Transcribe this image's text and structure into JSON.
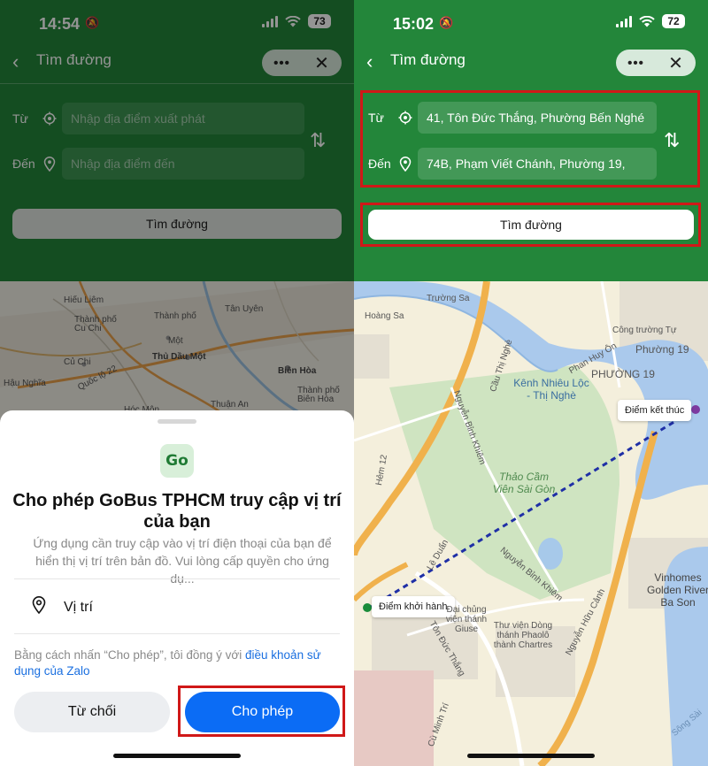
{
  "left": {
    "status": {
      "time": "14:54",
      "battery": "73"
    },
    "nav": {
      "title": "Tìm đường"
    },
    "form": {
      "from_label": "Từ",
      "to_label": "Đến",
      "from_placeholder": "Nhập địa điểm xuất phát",
      "to_placeholder": "Nhập địa điểm đến",
      "search_label": "Tìm đường"
    },
    "map_labels": {
      "hieu_liem": "Hiếu Liêm",
      "tan_uyen": "Tân Uyên",
      "thanh_pho_left": "Thành phố",
      "cu_chi_top": "Cu Chi",
      "thanh_pho_mid": "Thành phố",
      "mot": "Một",
      "thu_dau_mot": "Thủ Dầu Một",
      "bien_hoa": "Biên Hòa",
      "cu_chi": "Củ Chi",
      "quoc_lo": "Quốc lộ 22",
      "thanh_pho_right": "Thành phố",
      "bien_hoa_2": "Biên Hòa",
      "hau_nghia": "Hậu Nghĩa",
      "hoc_mon": "Hóc Môn",
      "thuan_an": "Thuận An"
    },
    "sheet": {
      "logo": "Go",
      "title": "Cho phép GoBus TPHCM truy cập vị trí của bạn",
      "description": "Ứng dụng cần truy cập vào vị trí điện thoại của bạn để hiển thị vị trí trên bản đồ. Vui lòng cấp quyền cho ứng dụ...",
      "permission": "Vị trí",
      "terms_text": "Bằng cách nhấn “Cho phép”, tôi đồng ý với ",
      "terms_link": "điều khoản sử dụng của Zalo",
      "deny": "Từ chối",
      "allow": "Cho phép"
    }
  },
  "right": {
    "status": {
      "time": "15:02",
      "battery": "72"
    },
    "nav": {
      "title": "Tìm đường"
    },
    "form": {
      "from_label": "Từ",
      "to_label": "Đến",
      "from_value": "41, Tôn Đức Thắng, Phường Bến Nghé",
      "to_value": "74B, Phạm Viết Chánh, Phường 19,",
      "search_label": "Tìm đường"
    },
    "map_labels": {
      "truong_sa": "Trường Sa",
      "hoang_sa": "Hoàng Sa",
      "cau_thi_nghe": "Cầu Thị Nghè",
      "phan_huy_on": "Phan Huy Ôn",
      "cong_truong_tu": "Công trường Tự",
      "phuong_19a": "Phường 19",
      "phuong_19b": "PHƯỜNG 19",
      "kenh_nhieu_loc": "Kênh Nhiêu Lộc - Thị Nghè",
      "diem_ket_thuc": "Điểm kết thúc",
      "nguyen_binh_khiem": "Nguyễn Bỉnh Khiêm",
      "thao_cam_vien": "Thảo Cầm Viên Sài Gòn",
      "hem_12": "Hẻm 12",
      "le_duan": "Lê Duẩn",
      "nguyen_binh_khiem_2": "Nguyễn Bỉnh Khiêm",
      "diem_khoi_hanh": "Điểm khởi hành",
      "vinhomes": "Vinhomes Golden River Ba Son",
      "nguyen_huu_canh": "Nguyễn Hữu Cảnh",
      "dai_chung_vien": "Đại chủng viện thánh Giuse",
      "thu_vien": "Thư viện Dòng thánh Phaolô thành Chartres",
      "ton_duc_thang": "Tôn Đức Thắng",
      "cu_minh_tri": "Cù Minh Trí",
      "song_sai_gon": "Sông Sài"
    }
  },
  "colors": {
    "header_green": "#23863a",
    "allow_blue": "#0b6cf5",
    "highlight_red": "#d01818",
    "route_blue": "#1f2fa6"
  }
}
